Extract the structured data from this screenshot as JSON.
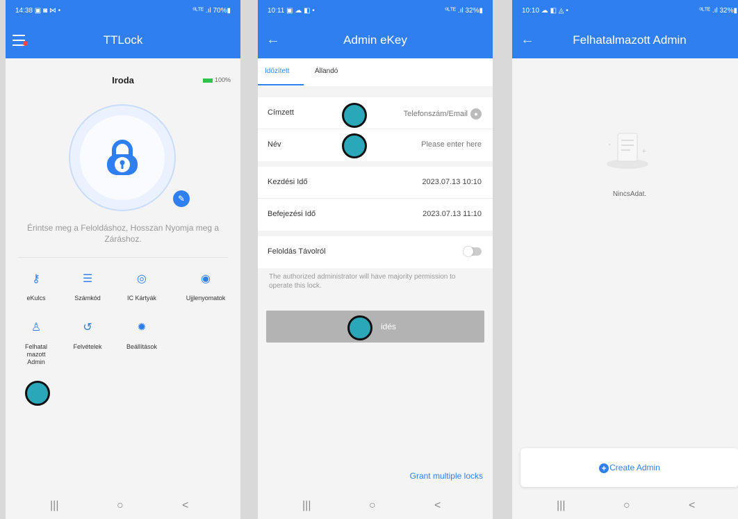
{
  "screen1": {
    "status": {
      "time": "14:38 ▣ ◙ ⋈ •",
      "right": "⁰ᴸᵀᴱ .ıl 70%▮"
    },
    "title": "TTLock",
    "lock_name": "Iroda",
    "battery": "100%",
    "hint": "Érintse meg a Feloldáshoz, Hosszan Nyomja meg a Záráshoz.",
    "menu": [
      {
        "icon": "ekey-icon",
        "label": "eKulcs"
      },
      {
        "icon": "passcode-icon",
        "label": "Számkód"
      },
      {
        "icon": "ic-card-icon",
        "label": "IC Kártyák"
      },
      {
        "icon": "fingerprint-icon",
        "label": "Ujjlenyomatok"
      },
      {
        "icon": "admin-icon",
        "label": "Felhatal mazott Admin"
      },
      {
        "icon": "history-icon",
        "label": "Felvételek"
      },
      {
        "icon": "settings-icon",
        "label": "Beállítások"
      }
    ]
  },
  "screen2": {
    "status": {
      "time": "10:11 ▣ ☁ ◧ •",
      "right": "⁰ᴸᵀᴱ .ıl 32%▮"
    },
    "title": "Admin eKey",
    "tabs": [
      "Időzített",
      "Állandó"
    ],
    "fields": {
      "recipient_label": "Címzett",
      "recipient_placeholder": "Telefonszám/Email",
      "name_label": "Név",
      "name_placeholder": "Please enter here",
      "start_label": "Kezdési Idő",
      "start_value": "2023.07.13 10:10",
      "end_label": "Befejezési Idő",
      "end_value": "2023.07.13 11:10",
      "remote_label": "Feloldás Távolról"
    },
    "note": "The authorized administrator will have majority permission to operate this lock.",
    "send_label": "idés",
    "grant_multiple": "Grant multiple locks"
  },
  "screen3": {
    "status": {
      "time": "10:10 ☁ ◧ ◬ •",
      "right": "⁰ᴸᵀᴱ .ıl 32%▮"
    },
    "title": "Felhatalmazott Admin",
    "empty_text": "NincsAdat.",
    "create_label": "Create Admin"
  },
  "nav": {
    "recents": "|||",
    "home": "○",
    "back": "<"
  },
  "colors": {
    "primary": "#2f7ff0",
    "marker": "#2aa7b8",
    "disabled": "#b3b3b3",
    "battery": "#2fc24d"
  }
}
